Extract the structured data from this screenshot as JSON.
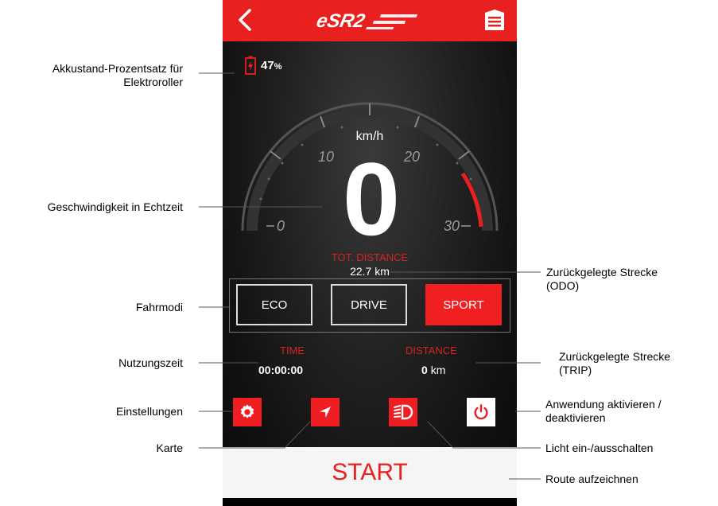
{
  "app": {
    "logo_text": "eSR2"
  },
  "battery": {
    "value": "47",
    "unit": "%"
  },
  "speedometer": {
    "unit": "km/h",
    "speed": "0",
    "scale_labels": [
      "0",
      "10",
      "20",
      "30"
    ]
  },
  "total_distance": {
    "label": "TOT. DISTANCE",
    "value": "22.7 km"
  },
  "modes": [
    {
      "label": "ECO",
      "active": false
    },
    {
      "label": "DRIVE",
      "active": false
    },
    {
      "label": "SPORT",
      "active": true
    }
  ],
  "trip": {
    "time_label": "TIME",
    "time_value": "00:00:00",
    "distance_label": "DISTANCE",
    "distance_number": "0",
    "distance_unit": "km"
  },
  "actions": {
    "settings_icon": "gear-icon",
    "map_icon": "navigation-arrow-icon",
    "light_icon": "headlight-icon",
    "power_icon": "power-icon"
  },
  "start_button": {
    "label": "START"
  },
  "colors": {
    "accent": "#e8201f",
    "background": "#1a1a1a",
    "start_bg": "#f5f5f5"
  },
  "annotations": {
    "battery": "Akkustand-Prozentsatz für\nElektroroller",
    "speed": "Geschwindigkeit in Echtzeit",
    "modes": "Fahrmodi",
    "usage_time": "Nutzungszeit",
    "settings": "Einstellungen",
    "map": "Karte",
    "odo": "Zurückgelegte Strecke\n(ODO)",
    "trip": "Zurückgelegte Strecke\n(TRIP)",
    "power": "Anwendung aktivieren /\ndeaktivieren",
    "light": "Licht ein-/ausschalten",
    "record": "Route aufzeichnen"
  }
}
